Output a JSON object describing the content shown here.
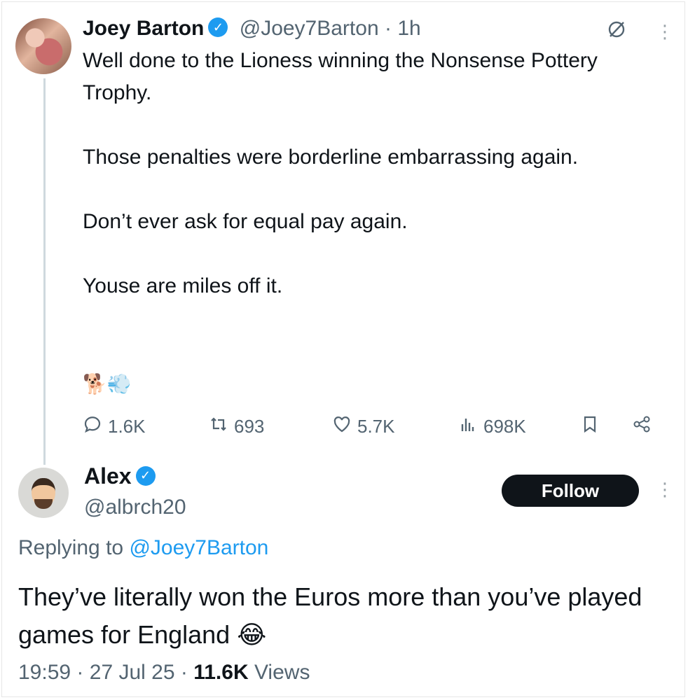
{
  "tweet": {
    "author_name": "Joey Barton",
    "handle": "@Joey7Barton",
    "separator": "·",
    "time": "1h",
    "paragraphs": [
      "Well done to the Lioness winning the Nonsense Pottery Trophy.",
      "Those penalties were borderline embarrassing again.",
      "Don’t ever ask for equal pay again.",
      "Youse are miles off it."
    ],
    "emojis": "🐕💨",
    "stats": {
      "replies": "1.6K",
      "reposts": "693",
      "likes": "5.7K",
      "views": "698K"
    }
  },
  "reply": {
    "author_name": "Alex",
    "handle": "@albrch20",
    "follow_label": "Follow",
    "replying_prefix": "Replying to",
    "replying_to": "@Joey7Barton",
    "text": "They’ve literally won the Euros more than you’ve played games for England 😂",
    "time": "19:59",
    "date": "27 Jul 25",
    "view_count": "11.6K",
    "views_label": "Views",
    "separator": "·"
  },
  "colors": {
    "accent": "#1d9bf0",
    "muted": "#536471",
    "text": "#0f1419",
    "thread_line": "#cfd9de"
  },
  "icons": [
    "verified-badge-icon",
    "grok-icon",
    "more-icon",
    "reply-icon",
    "repost-icon",
    "like-icon",
    "views-icon",
    "bookmark-icon",
    "share-icon"
  ]
}
